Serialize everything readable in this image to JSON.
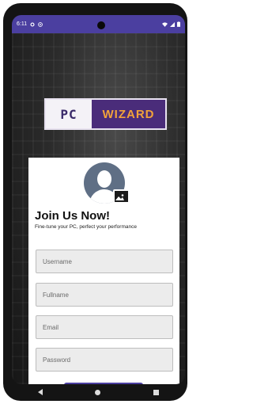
{
  "status_bar": {
    "time": "6:11",
    "left_icons": [
      "settings-icon",
      "notification-icon"
    ],
    "right_icons": [
      "wifi-icon",
      "signal-icon",
      "battery-icon"
    ]
  },
  "logo": {
    "left": "PC",
    "right": "WIZARD"
  },
  "form": {
    "title": "Join Us Now!",
    "subtitle": "Fine-tune your PC, perfect your performance",
    "fields": [
      {
        "placeholder": "Username",
        "value": ""
      },
      {
        "placeholder": "Fullname",
        "value": ""
      },
      {
        "placeholder": "Email",
        "value": ""
      },
      {
        "placeholder": "Password",
        "value": ""
      }
    ]
  },
  "colors": {
    "accent": "#4b3fa0",
    "logo_background": "#4a2c7a",
    "logo_text": "#f2a33a"
  },
  "nav": {
    "icons": [
      "back-icon",
      "home-icon",
      "recents-icon"
    ]
  }
}
